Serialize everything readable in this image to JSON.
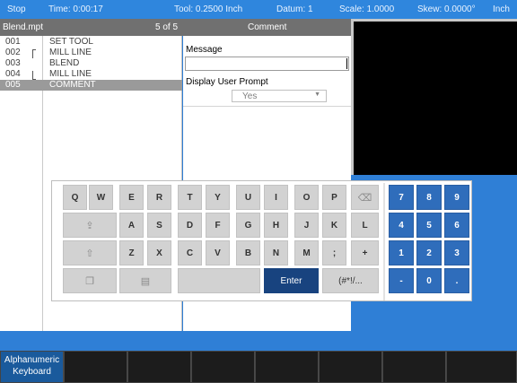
{
  "status": {
    "mode": "Stop",
    "time": "Time: 0:00:17",
    "tool": "Tool: 0.2500 Inch",
    "datum": "Datum: 1",
    "scale": "Scale: 1.0000",
    "skew": "Skew: 0.0000°",
    "units": "Inch"
  },
  "program": {
    "filename": "Blend.mpt",
    "position": "5 of 5",
    "step_type": "Comment",
    "steps": [
      {
        "num": "001",
        "cmd": "SET TOOL"
      },
      {
        "num": "002",
        "cmd": "MILL LINE"
      },
      {
        "num": "003",
        "cmd": "BLEND"
      },
      {
        "num": "004",
        "cmd": "MILL LINE"
      },
      {
        "num": "005",
        "cmd": "COMMENT"
      }
    ]
  },
  "form": {
    "message_label": "Message",
    "message_value": "",
    "prompt_label": "Display User Prompt",
    "prompt_value": "Yes"
  },
  "keyboard": {
    "row1": [
      "Q",
      "W",
      "E",
      "R",
      "T",
      "Y",
      "U",
      "I",
      "O",
      "P"
    ],
    "row2": [
      "A",
      "S",
      "D",
      "F",
      "G",
      "H",
      "J",
      "K",
      "L"
    ],
    "row3": [
      "Z",
      "X",
      "C",
      "V",
      "B",
      "N",
      "M",
      ";",
      "+"
    ],
    "enter": "Enter",
    "symbols": "(#*!/...",
    "numpad": [
      "7",
      "8",
      "9",
      "4",
      "5",
      "6",
      "1",
      "2",
      "3",
      "-",
      "0",
      "."
    ]
  },
  "softkeys": {
    "active_line1": "Alphanumeric",
    "active_line2": "Keyboard"
  },
  "icons": {
    "backspace": "backspace-icon",
    "caps": "caps-lock-icon",
    "shift": "shift-icon",
    "clear": "clear-icon",
    "copy": "copy-icon",
    "paste": "paste-icon"
  },
  "colors": {
    "background": "#2f7fd6",
    "num_key": "#2f6dbb",
    "enter_key": "#18437f",
    "softkey_active": "#1a5a9c"
  }
}
